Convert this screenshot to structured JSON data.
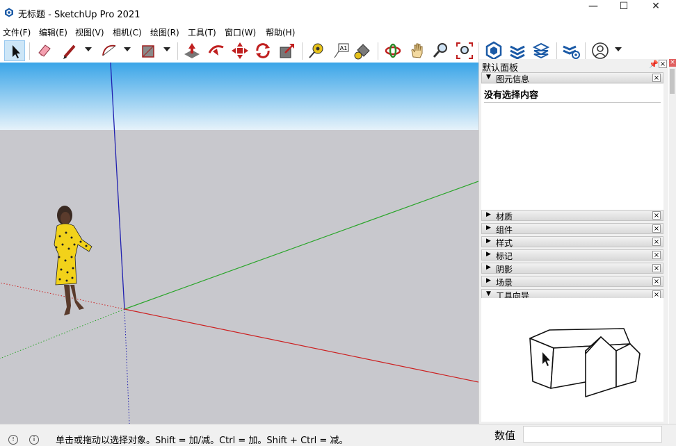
{
  "window": {
    "title": "无标题 - SketchUp Pro 2021",
    "minimize": "—",
    "maximize": "☐",
    "close": "✕"
  },
  "menu": [
    "文件(F)",
    "编辑(E)",
    "视图(V)",
    "相机(C)",
    "绘图(R)",
    "工具(T)",
    "窗口(W)",
    "帮助(H)"
  ],
  "toolbar": {
    "active_tool": "select",
    "tools": [
      "select-icon",
      "eraser-icon",
      "pencil-icon",
      "arc-icon",
      "rectangle-icon",
      "push-pull-icon",
      "follow-me-icon",
      "move-icon",
      "rotate-icon",
      "scale-icon",
      "tape-measure-icon",
      "text-icon",
      "paint-bucket-icon",
      "orbit-icon",
      "pan-icon",
      "zoom-icon",
      "zoom-extents-icon",
      "warehouse-icon",
      "extension-warehouse-icon",
      "layout-icon",
      "extension-manager-icon",
      "account-icon"
    ]
  },
  "colors": {
    "sky_top": "#3aa5e8",
    "sky_bottom": "#e6f2fa",
    "ground": "#c8c8cd",
    "axis_red": "#cc2020",
    "axis_green": "#2aa52a",
    "axis_blue": "#2020b0",
    "active_tool_bg": "#cde6f7"
  },
  "panel": {
    "title": "默认面板",
    "pin": "📌",
    "close": "×",
    "entity_info": {
      "label": "图元信息",
      "empty_text": "没有选择内容"
    },
    "trays": [
      "材质",
      "组件",
      "样式",
      "标记",
      "阴影",
      "场景"
    ],
    "instructor": {
      "label": "工具向导"
    }
  },
  "status": {
    "hint": "单击或拖动以选择对象。Shift = 加/减。Ctrl = 加。Shift + Ctrl = 减。",
    "measurements_label": "数值",
    "measurements_value": ""
  }
}
